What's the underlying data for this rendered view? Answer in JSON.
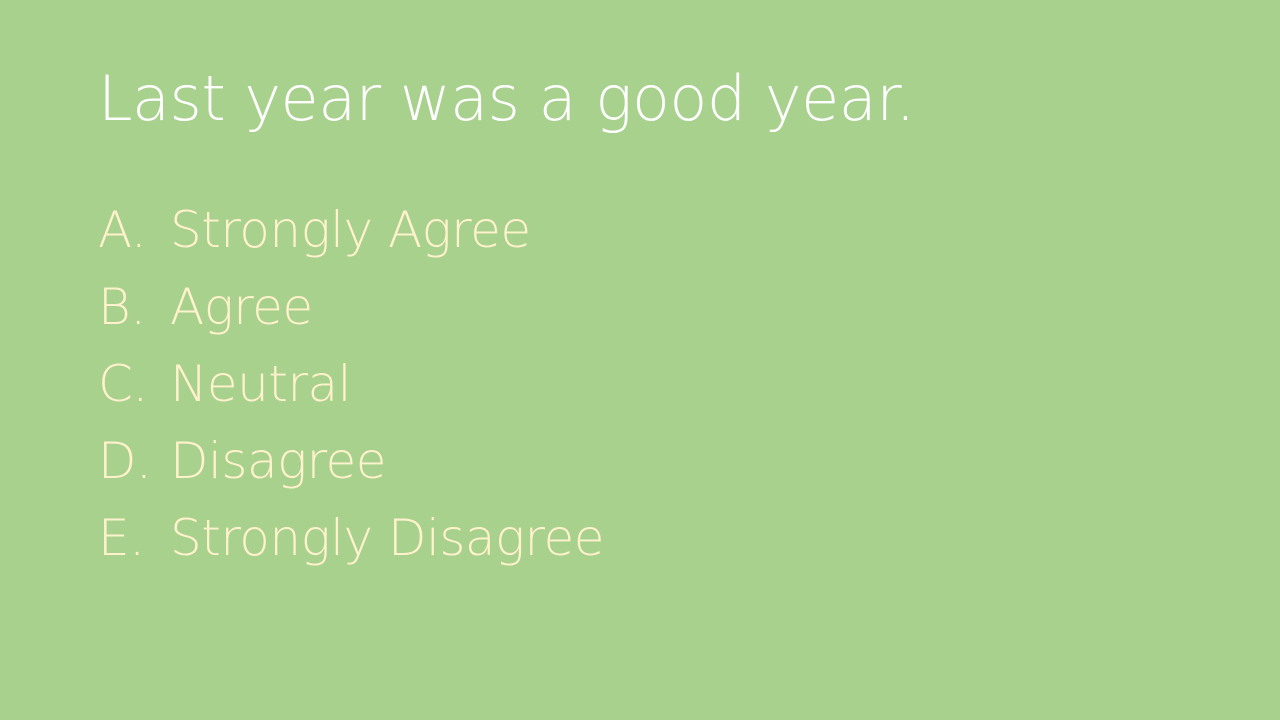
{
  "slide": {
    "title": "Last year was a good year.",
    "options": [
      {
        "letter": "A.",
        "text": "Strongly Agree"
      },
      {
        "letter": "B.",
        "text": "Agree"
      },
      {
        "letter": "C.",
        "text": "Neutral"
      },
      {
        "letter": "D.",
        "text": "Disagree"
      },
      {
        "letter": "E.",
        "text": "Strongly Disagree"
      }
    ]
  },
  "colors": {
    "background": "#a9d18e",
    "title": "#ffffff",
    "options": "#fff2cc"
  }
}
